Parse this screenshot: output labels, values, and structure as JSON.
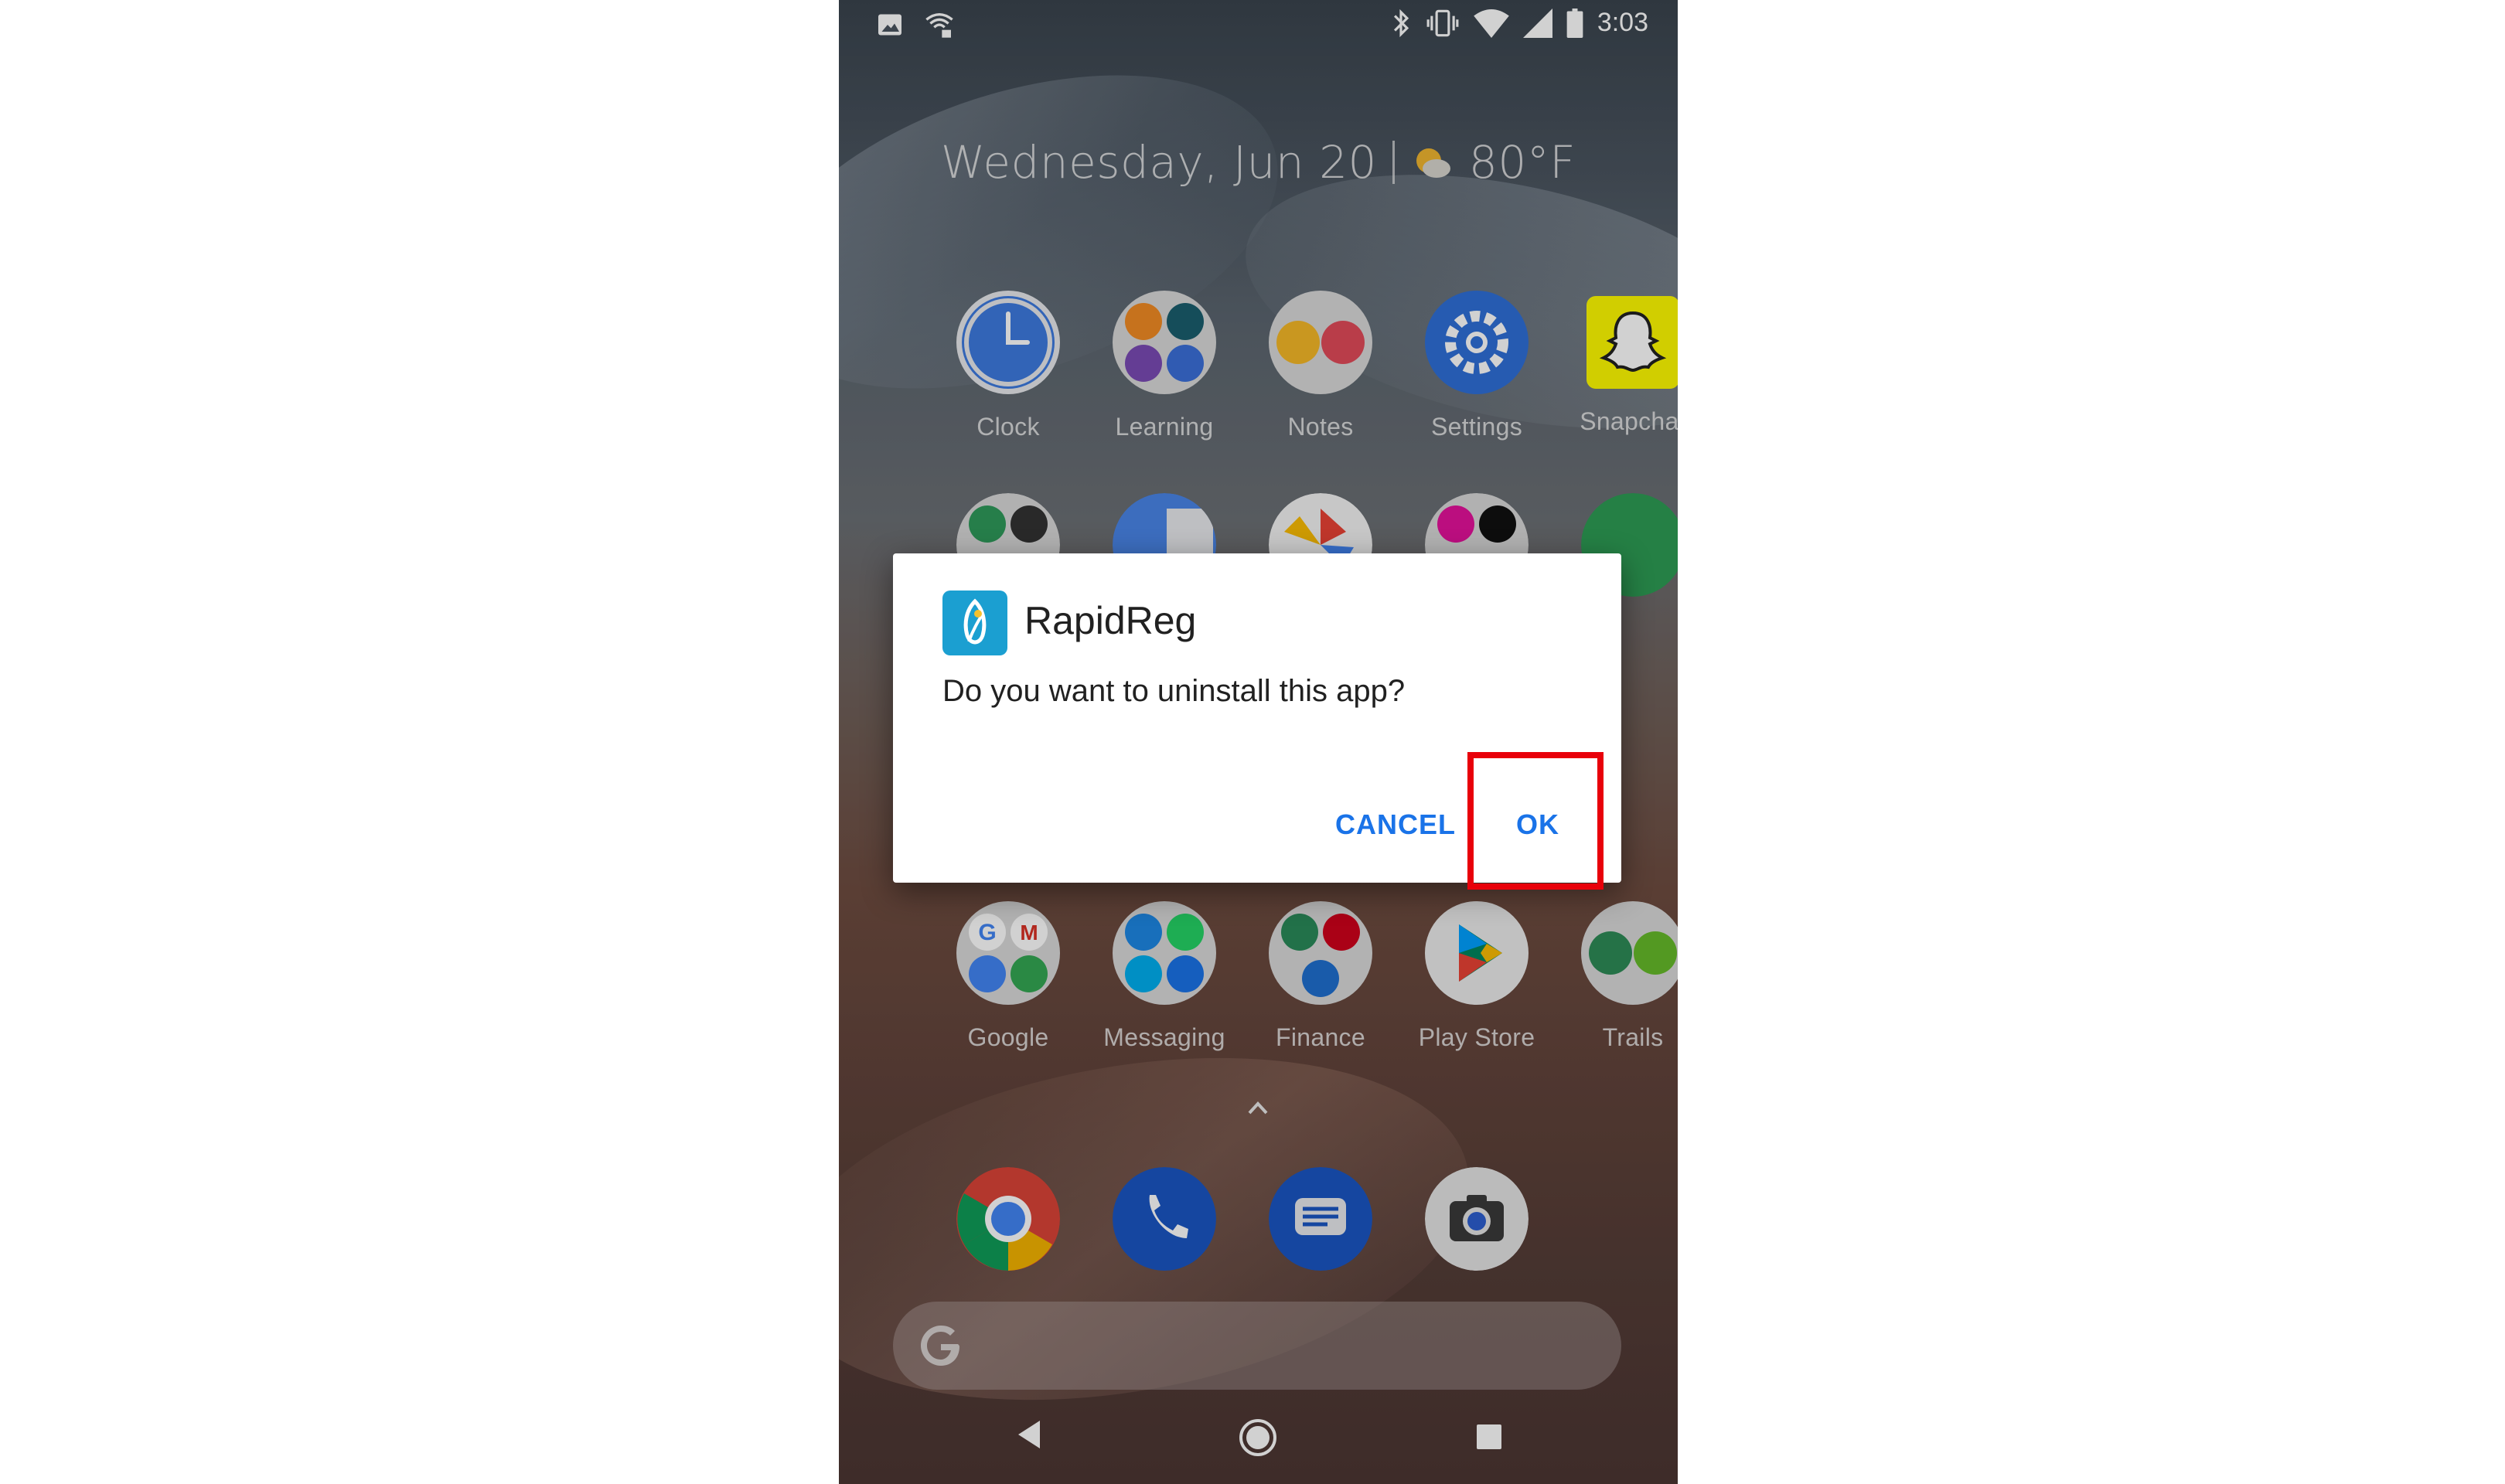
{
  "status_bar": {
    "time": "3:03",
    "left_icons": [
      "image-notification-icon",
      "wifi-settings-icon"
    ],
    "right_icons": [
      "bluetooth-icon",
      "vibrate-icon",
      "wifi-icon",
      "cell-signal-icon",
      "battery-icon"
    ]
  },
  "home": {
    "date": "Wednesday, Jun 20",
    "temperature": "80°F",
    "weather_icon": "partly-sunny-icon"
  },
  "apps_row1": [
    {
      "label": "Clock",
      "icon": "clock-icon"
    },
    {
      "label": "Learning",
      "icon": "learning-folder-icon"
    },
    {
      "label": "Notes",
      "icon": "notes-folder-icon"
    },
    {
      "label": "Settings",
      "icon": "settings-gear-icon"
    },
    {
      "label": "Snapchat",
      "icon": "snapchat-ghost-icon"
    }
  ],
  "apps_row3": [
    {
      "label": "Google",
      "icon": "google-folder-icon"
    },
    {
      "label": "Messaging",
      "icon": "messaging-folder-icon"
    },
    {
      "label": "Finance",
      "icon": "finance-folder-icon"
    },
    {
      "label": "Play Store",
      "icon": "play-store-icon"
    },
    {
      "label": "Trails",
      "icon": "trails-folder-icon"
    }
  ],
  "dock": [
    "chrome-icon",
    "phone-icon",
    "messages-icon",
    "camera-icon"
  ],
  "dialog": {
    "app_name": "RapidReg",
    "message": "Do you want to uninstall this app?",
    "cancel_label": "CANCEL",
    "ok_label": "OK"
  },
  "colors": {
    "accent": "#1a73e8",
    "highlight": "#e8000a",
    "app_icon_bg": "#1b9fd1"
  }
}
